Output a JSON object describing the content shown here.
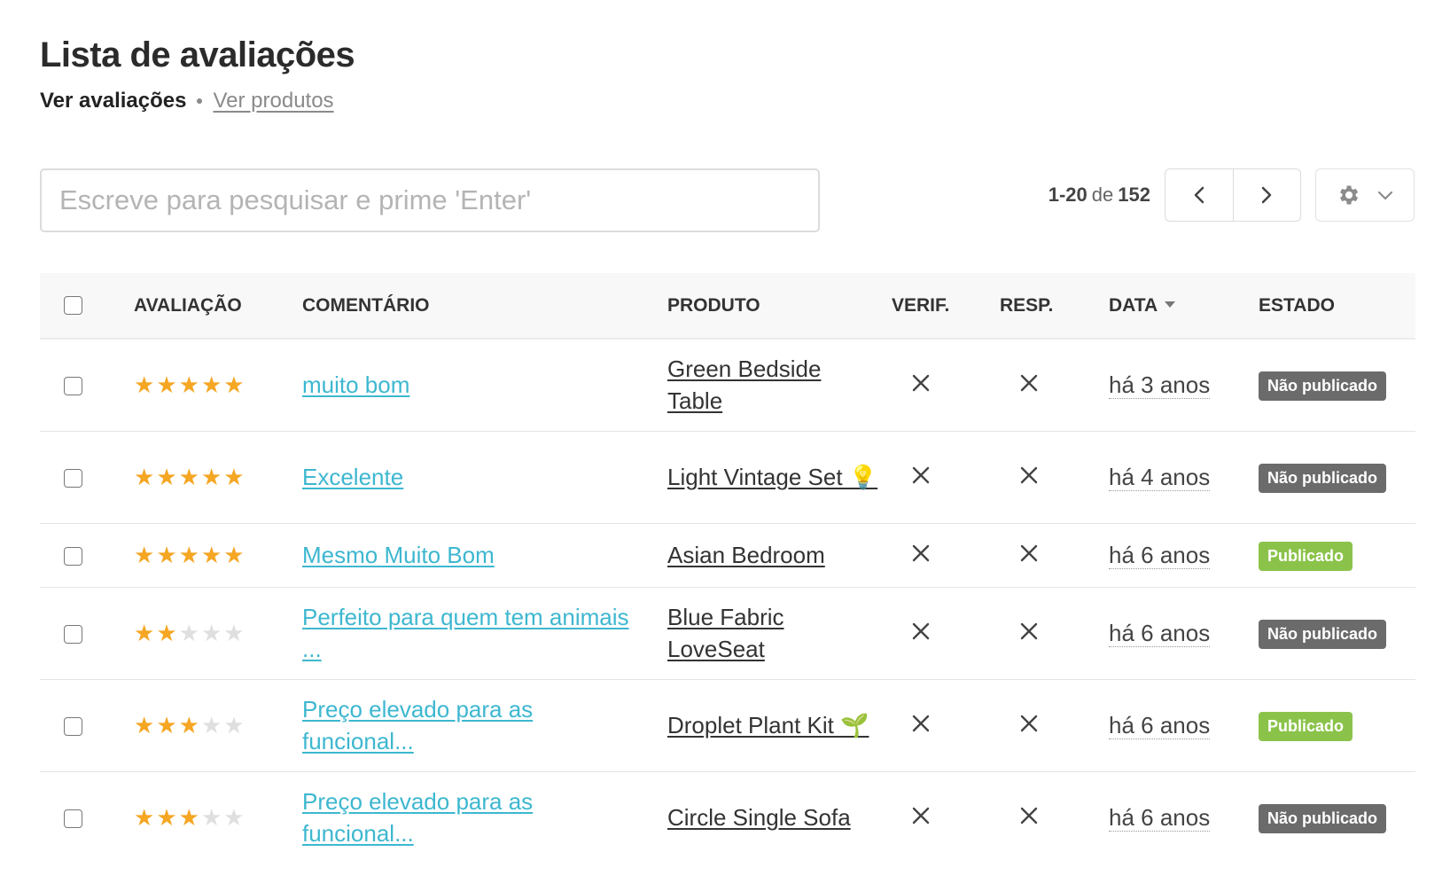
{
  "header": {
    "title": "Lista de avaliações",
    "nav_active": "Ver avaliações",
    "nav_link": "Ver produtos"
  },
  "search": {
    "placeholder": "Escreve para pesquisar e prime 'Enter'",
    "value": ""
  },
  "pagination": {
    "range": "1-20",
    "of": "de",
    "total": "152",
    "prev_icon": "chevron-left-icon",
    "next_icon": "chevron-right-icon"
  },
  "settings": {
    "icon": "gear-icon",
    "dropdown_icon": "chevron-down-icon"
  },
  "table": {
    "columns": {
      "rating": "AVALIAÇÃO",
      "comment": "COMENTÁRIO",
      "product": "PRODUTO",
      "verified": "VERIF.",
      "replied": "RESP.",
      "date": "DATA",
      "status": "ESTADO"
    },
    "rows": [
      {
        "rating": 5,
        "comment": "muito bom",
        "product": "Green Bedside Table",
        "verified": false,
        "replied": false,
        "date": "há 3 anos",
        "status": "Não publicado",
        "published": false
      },
      {
        "rating": 5,
        "comment": "Excelente",
        "product": "Light Vintage Set 💡",
        "verified": false,
        "replied": false,
        "date": "há 4 anos",
        "status": "Não publicado",
        "published": false
      },
      {
        "rating": 5,
        "comment": "Mesmo Muito Bom",
        "product": "Asian Bedroom",
        "verified": false,
        "replied": false,
        "date": "há 6 anos",
        "status": "Publicado",
        "published": true
      },
      {
        "rating": 2,
        "comment": "Perfeito para quem tem animais ...",
        "product": "Blue Fabric LoveSeat",
        "verified": false,
        "replied": false,
        "date": "há 6 anos",
        "status": "Não publicado",
        "published": false
      },
      {
        "rating": 3,
        "comment": "Preço elevado para as funcional...",
        "product": "Droplet Plant Kit 🌱",
        "verified": false,
        "replied": false,
        "date": "há 6 anos",
        "status": "Publicado",
        "published": true
      },
      {
        "rating": 3,
        "comment": "Preço elevado para as funcional...",
        "product": "Circle Single Sofa",
        "verified": false,
        "replied": false,
        "date": "há 6 anos",
        "status": "Não publicado",
        "published": false
      }
    ]
  },
  "colors": {
    "star_on": "#f5a623",
    "star_off": "#dfdfdf",
    "comment_link": "#3db7d0",
    "badge_unpublished": "#6b6b6b",
    "badge_published": "#8bc34a"
  }
}
